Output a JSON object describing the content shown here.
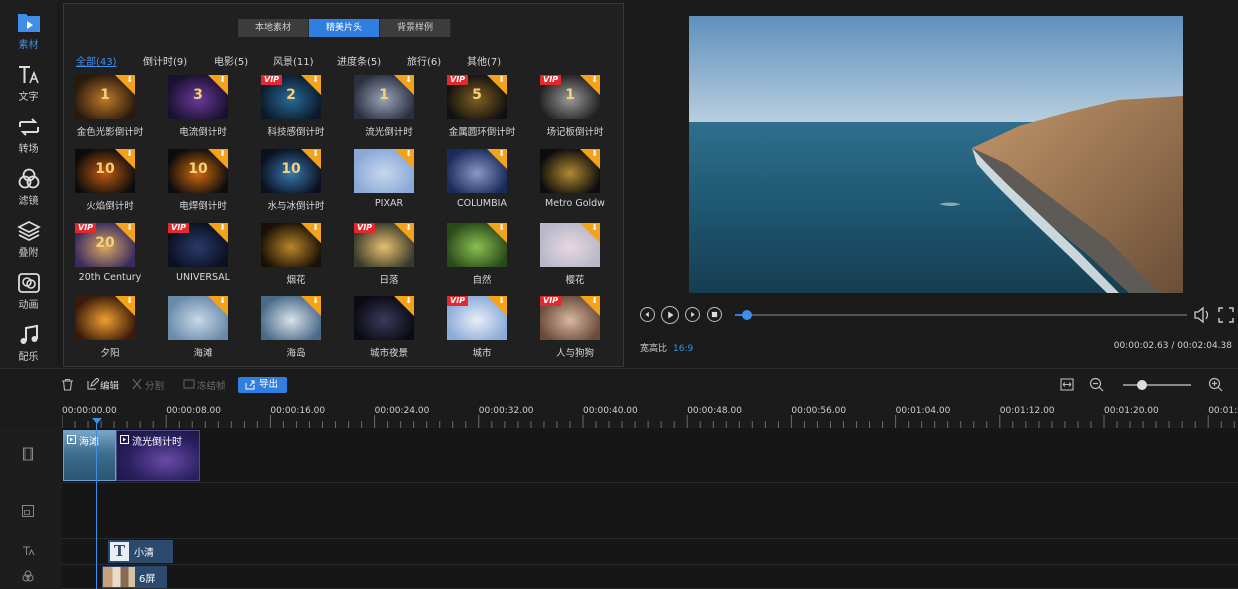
{
  "sidebar": {
    "items": [
      {
        "label": "素材",
        "icon": "material-icon",
        "active": true
      },
      {
        "label": "文字",
        "icon": "text-icon"
      },
      {
        "label": "转场",
        "icon": "transition-icon"
      },
      {
        "label": "滤镜",
        "icon": "filter-icon"
      },
      {
        "label": "叠附",
        "icon": "overlay-icon"
      },
      {
        "label": "动画",
        "icon": "animation-icon"
      },
      {
        "label": "配乐",
        "icon": "music-icon"
      }
    ]
  },
  "material": {
    "tabs": [
      {
        "label": "本地素材"
      },
      {
        "label": "精美片头",
        "active": true
      },
      {
        "label": "背景样例"
      }
    ],
    "categories": [
      {
        "label": "全部(43)",
        "active": true
      },
      {
        "label": "倒计时(9)"
      },
      {
        "label": "电影(5)"
      },
      {
        "label": "风景(11)"
      },
      {
        "label": "进度条(5)"
      },
      {
        "label": "旅行(6)"
      },
      {
        "label": "其他(7)"
      }
    ],
    "items": [
      {
        "label": "金色光影倒计时",
        "vip": false,
        "glyph": "1"
      },
      {
        "label": "电流倒计时",
        "vip": false,
        "glyph": "3"
      },
      {
        "label": "科技感倒计时",
        "vip": true,
        "glyph": "2"
      },
      {
        "label": "流光倒计时",
        "vip": false,
        "glyph": "1"
      },
      {
        "label": "金属圆环倒计时",
        "vip": true,
        "glyph": "5"
      },
      {
        "label": "场记板倒计时",
        "vip": true,
        "glyph": "1"
      },
      {
        "label": "火焰倒计时",
        "vip": false,
        "glyph": "10"
      },
      {
        "label": "电焊倒计时",
        "vip": false,
        "glyph": "10"
      },
      {
        "label": "水与冰倒计时",
        "vip": false,
        "glyph": "10"
      },
      {
        "label": "PIXAR",
        "vip": false,
        "glyph": ""
      },
      {
        "label": "COLUMBIA",
        "vip": false,
        "glyph": ""
      },
      {
        "label": "Metro Goldw",
        "vip": false,
        "glyph": ""
      },
      {
        "label": "20th Century",
        "vip": true,
        "glyph": "20"
      },
      {
        "label": "UNIVERSAL",
        "vip": true,
        "glyph": ""
      },
      {
        "label": "烟花",
        "vip": false,
        "glyph": ""
      },
      {
        "label": "日落",
        "vip": true,
        "glyph": ""
      },
      {
        "label": "自然",
        "vip": false,
        "glyph": ""
      },
      {
        "label": "樱花",
        "vip": false,
        "glyph": ""
      },
      {
        "label": "夕阳",
        "vip": false,
        "glyph": ""
      },
      {
        "label": "海滩",
        "vip": false,
        "glyph": ""
      },
      {
        "label": "海岛",
        "vip": false,
        "glyph": ""
      },
      {
        "label": "城市夜景",
        "vip": false,
        "glyph": ""
      },
      {
        "label": "城市",
        "vip": true,
        "glyph": ""
      },
      {
        "label": "人与狗狗",
        "vip": true,
        "glyph": ""
      }
    ],
    "vip_label": "VIP",
    "download_glyph": "⬇"
  },
  "player": {
    "aspect_label": "宽高比",
    "aspect_value": "16:9",
    "current_time": "00:00:02.63",
    "separator": "/",
    "total_time": "00:02:04.38",
    "progress_fraction": 0.021
  },
  "toolbar": {
    "edit_label": "编辑",
    "split_label": "分割",
    "freeze_label": "冻结帧",
    "export_label": "导出"
  },
  "timeline": {
    "ticks": [
      "00:00:00.00",
      "00:00:08.00",
      "00:00:16.00",
      "00:00:24.00",
      "00:00:32.00",
      "00:00:40.00",
      "00:00:48.00",
      "00:00:56.00",
      "00:01:04.00",
      "00:01:12.00",
      "00:01:20.00",
      "00:01:2"
    ],
    "video_clips": [
      {
        "label": "海滩"
      },
      {
        "label": "流光倒计时"
      }
    ],
    "text_clip": {
      "label": "小清"
    },
    "overlay_clip": {
      "label": "6屏"
    },
    "text_clip_glyph": "T"
  },
  "colors": {
    "accent": "#2f7ee0",
    "vip_red": "#e3282e",
    "badge_orange": "#f4a21a",
    "background": "#1b1b1b"
  }
}
